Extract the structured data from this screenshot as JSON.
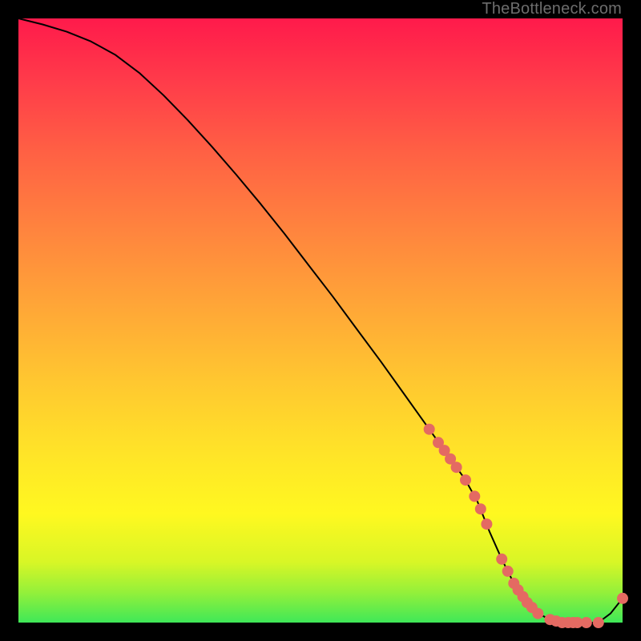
{
  "watermark": "TheBottleneck.com",
  "colors": {
    "marker": "#e46a62",
    "line": "#000000"
  },
  "chart_data": {
    "type": "line",
    "title": "",
    "xlabel": "",
    "ylabel": "",
    "xlim": [
      0,
      100
    ],
    "ylim": [
      0,
      100
    ],
    "grid": false,
    "legend": false,
    "x": [
      0,
      4,
      8,
      12,
      16,
      20,
      24,
      28,
      32,
      36,
      40,
      44,
      48,
      52,
      56,
      60,
      64,
      68,
      70,
      72,
      74,
      76,
      78,
      80,
      82,
      84,
      86,
      88,
      90,
      92,
      94,
      96,
      98,
      100
    ],
    "values": [
      100,
      99,
      97.8,
      96.2,
      94,
      91,
      87.3,
      83.2,
      78.8,
      74.2,
      69.4,
      64.4,
      59.2,
      54,
      48.6,
      43.2,
      37.6,
      32,
      29.2,
      26.4,
      23.6,
      20,
      15,
      10.5,
      6.5,
      3.5,
      1.5,
      0.5,
      0,
      0,
      0,
      0,
      1.5,
      4
    ],
    "marker_points": [
      {
        "x": 68,
        "y": 32.0
      },
      {
        "x": 69.5,
        "y": 29.8
      },
      {
        "x": 70.5,
        "y": 28.5
      },
      {
        "x": 71.5,
        "y": 27.1
      },
      {
        "x": 72.5,
        "y": 25.7
      },
      {
        "x": 74,
        "y": 23.6
      },
      {
        "x": 75.5,
        "y": 20.9
      },
      {
        "x": 76.5,
        "y": 18.8
      },
      {
        "x": 77.5,
        "y": 16.3
      },
      {
        "x": 80,
        "y": 10.5
      },
      {
        "x": 81,
        "y": 8.5
      },
      {
        "x": 82,
        "y": 6.5
      },
      {
        "x": 82.7,
        "y": 5.4
      },
      {
        "x": 83.5,
        "y": 4.3
      },
      {
        "x": 84.2,
        "y": 3.3
      },
      {
        "x": 85,
        "y": 2.5
      },
      {
        "x": 86,
        "y": 1.5
      },
      {
        "x": 88,
        "y": 0.5
      },
      {
        "x": 89,
        "y": 0.25
      },
      {
        "x": 90,
        "y": 0
      },
      {
        "x": 91,
        "y": 0
      },
      {
        "x": 91.8,
        "y": 0
      },
      {
        "x": 92.5,
        "y": 0
      },
      {
        "x": 94,
        "y": 0
      },
      {
        "x": 96,
        "y": 0
      },
      {
        "x": 100,
        "y": 4
      }
    ],
    "marker_radius_px": 7
  }
}
